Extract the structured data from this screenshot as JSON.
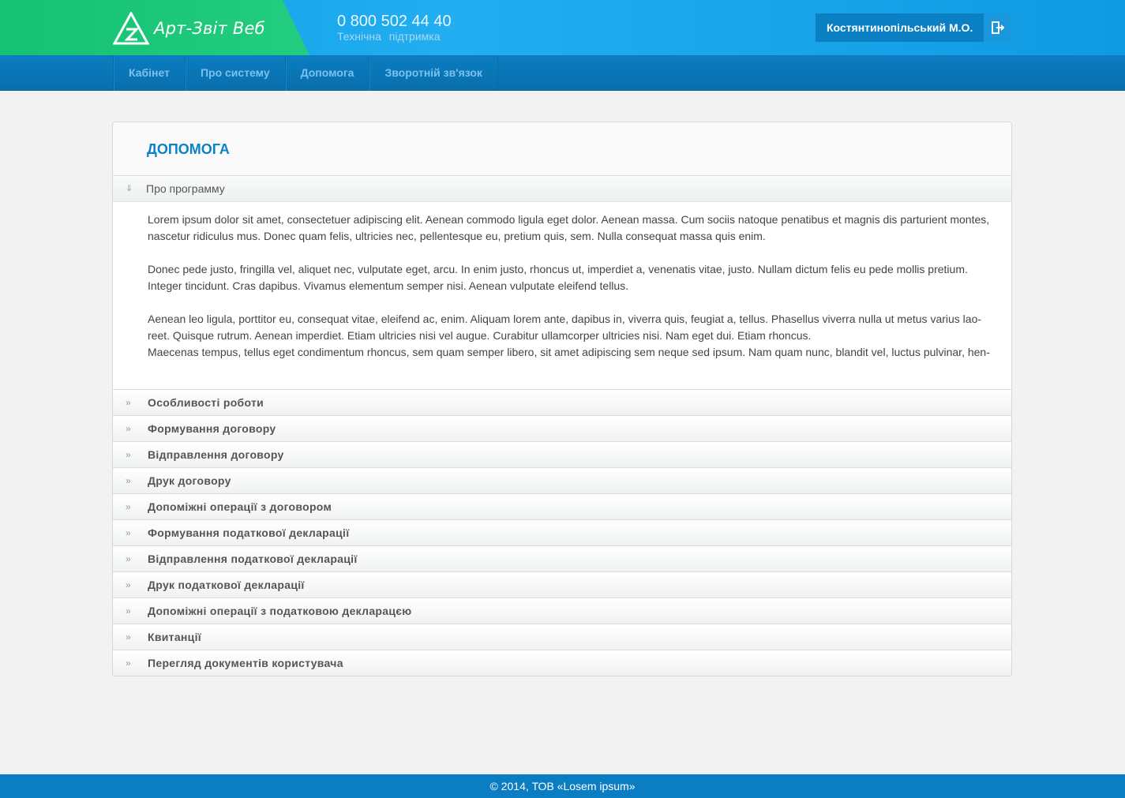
{
  "header": {
    "logo_text": "Арт-Звіт Веб",
    "phone": "0 800 502 44 40",
    "phone_label": "Технічна підтримка",
    "user_name": "Костянтинопільський М.О."
  },
  "nav": {
    "items": [
      {
        "label": "Кабінет"
      },
      {
        "label": "Про систему"
      },
      {
        "label": "Допомога"
      },
      {
        "label": "Зворотній зв'язок"
      }
    ]
  },
  "panel": {
    "title": "ДОПОМОГА",
    "open_section": {
      "label": "Про программу",
      "paragraphs": [
        "Lorem ipsum dolor sit amet, consectetuer adipiscing elit. Aenean commodo ligula eget dolor. Aenean massa. Cum sociis natoque penatibus et magnis dis parturient montes, nascetur ridiculus mus. Donec quam felis, ultricies nec, pellentesque eu, pretium quis, sem. Nulla consequat massa quis enim.",
        "Donec pede justo, fringilla vel, aliquet nec, vulputate eget, arcu. In enim justo, rhoncus ut, imperdiet a, venenatis vitae, justo. Nullam dictum felis eu pede mollis pretium. Integer tincidunt. Cras dapibus. Vivamus elementum semper nisi. Aenean vulputate eleifend tellus.",
        "Aenean leo ligula, porttitor eu, consequat vitae, eleifend ac, enim. Aliquam lorem ante, dapibus in, viverra quis, feugiat a, tellus. Phasellus viverra nulla ut metus varius lao- reet. Quisque rutrum. Aenean imperdiet. Etiam ultricies nisi vel augue. Curabitur ullamcorper ultricies nisi. Nam eget dui. Etiam rhoncus.",
        "Maecenas tempus, tellus eget condimentum rhoncus, sem quam semper libero, sit amet adipiscing sem neque sed ipsum. Nam quam nunc, blandit vel, luctus pulvinar, hen-"
      ]
    },
    "sections": [
      "Особливості роботи",
      "Формування договору",
      "Відправлення договору",
      "Друк договору",
      "Допоміжні операції з договором",
      "Формування податкової декларації",
      "Відправлення податкової декларації",
      "Друк податкової декларації",
      "Допоміжні операції з податковою декларацєю",
      "Квитанції",
      "Перегляд документів користувача"
    ]
  },
  "footer": {
    "text": "© 2014, ТОВ «Losem ipsum»"
  },
  "colors": {
    "brand_green": "#1fc97b",
    "brand_blue": "#0b7dc2",
    "title_blue": "#0b82c7"
  }
}
